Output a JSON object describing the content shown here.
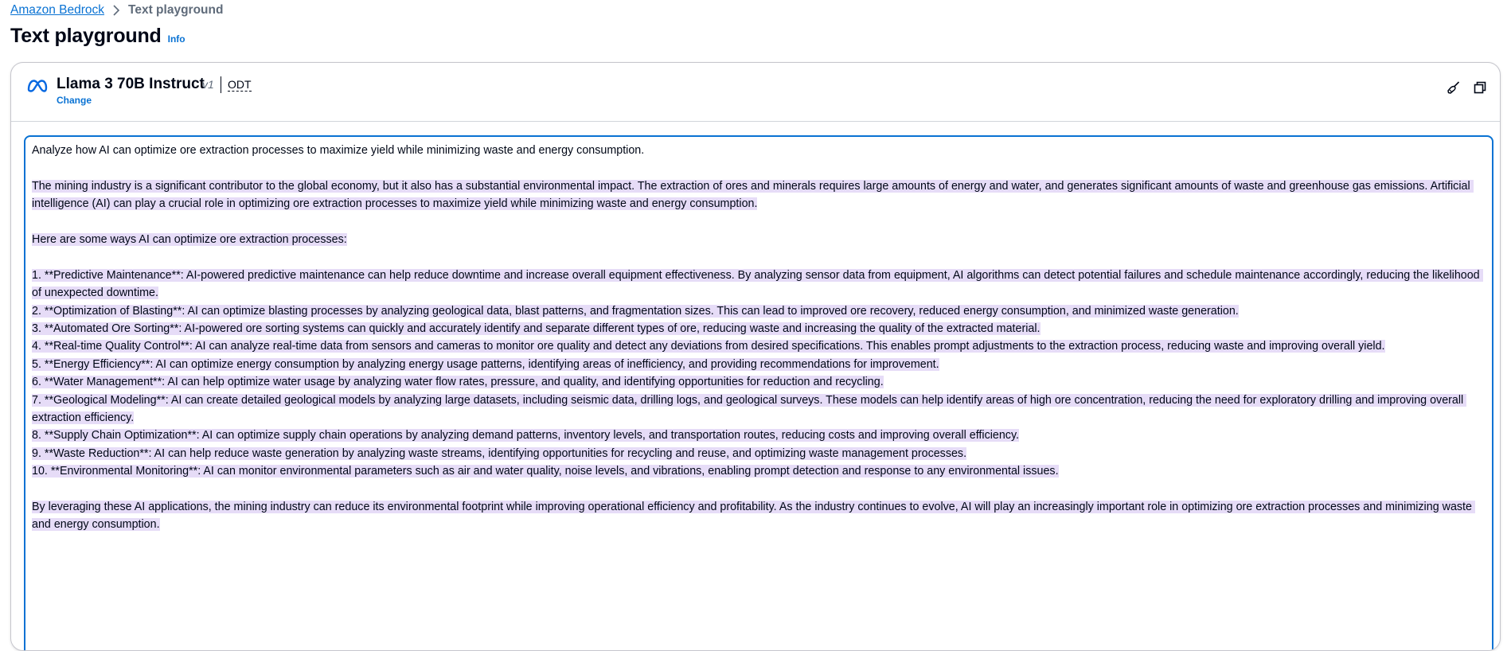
{
  "breadcrumb": {
    "root": "Amazon Bedrock",
    "current": "Text playground"
  },
  "header": {
    "title": "Text playground",
    "info": "Info"
  },
  "model": {
    "name": "Llama 3 70B Instruct",
    "version": "v1",
    "tag": "ODT",
    "change": "Change",
    "icons": [
      "meta-logo",
      "clear-brush-icon",
      "copy-icon"
    ]
  },
  "editor": {
    "prompt": "Analyze how AI can optimize ore extraction processes to maximize yield while minimizing waste and energy consumption.",
    "intro": "The mining industry is a significant contributor to the global economy, but it also has a substantial environmental impact. The extraction of ores and minerals requires large amounts of energy and water, and generates significant amounts of waste and greenhouse gas emissions. Artificial intelligence (AI) can play a crucial role in optimizing ore extraction processes to maximize yield while minimizing waste and energy consumption.",
    "lead": "Here are some ways AI can optimize ore extraction processes:",
    "items": [
      "1. **Predictive Maintenance**: AI-powered predictive maintenance can help reduce downtime and increase overall equipment effectiveness. By analyzing sensor data from equipment, AI algorithms can detect potential failures and schedule maintenance accordingly, reducing the likelihood of unexpected downtime.",
      "2. **Optimization of Blasting**: AI can optimize blasting processes by analyzing geological data, blast patterns, and fragmentation sizes. This can lead to improved ore recovery, reduced energy consumption, and minimized waste generation.",
      "3. **Automated Ore Sorting**: AI-powered ore sorting systems can quickly and accurately identify and separate different types of ore, reducing waste and increasing the quality of the extracted material.",
      "4. **Real-time Quality Control**: AI can analyze real-time data from sensors and cameras to monitor ore quality and detect any deviations from desired specifications. This enables prompt adjustments to the extraction process, reducing waste and improving overall yield.",
      "5. **Energy Efficiency**: AI can optimize energy consumption by analyzing energy usage patterns, identifying areas of inefficiency, and providing recommendations for improvement.",
      "6. **Water Management**: AI can help optimize water usage by analyzing water flow rates, pressure, and quality, and identifying opportunities for reduction and recycling.",
      "7. **Geological Modeling**: AI can create detailed geological models by analyzing large datasets, including seismic data, drilling logs, and geological surveys. These models can help identify areas of high ore concentration, reducing the need for exploratory drilling and improving overall extraction efficiency.",
      "8. **Supply Chain Optimization**: AI can optimize supply chain operations by analyzing demand patterns, inventory levels, and transportation routes, reducing costs and improving overall efficiency.",
      "9. **Waste Reduction**: AI can help reduce waste generation by analyzing waste streams, identifying opportunities for recycling and reuse, and optimizing waste management processes.",
      "10. **Environmental Monitoring**: AI can monitor environmental parameters such as air and water quality, noise levels, and vibrations, enabling prompt detection and response to any environmental issues."
    ],
    "conclusion": "By leveraging these AI applications, the mining industry can reduce its environmental footprint while improving operational efficiency and profitability. As the industry continues to evolve, AI will play an increasingly important role in optimizing ore extraction processes and minimizing waste and energy consumption."
  },
  "colors": {
    "link": "#0972d3",
    "text": "#000716",
    "highlight": "#e6dcf7",
    "focus_border": "#0972d3"
  }
}
